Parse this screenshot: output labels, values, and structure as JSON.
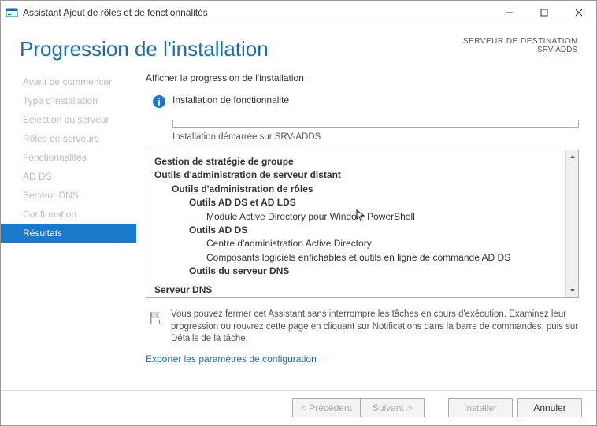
{
  "titlebar": {
    "title": "Assistant Ajout de rôles et de fonctionnalités"
  },
  "header": {
    "page_title": "Progression de l'installation",
    "dest_label": "SERVEUR DE DESTINATION",
    "dest_server": "SRV-ADDS"
  },
  "sidebar": {
    "steps": [
      "Avant de commencer",
      "Type d'installation",
      "Sélection du serveur",
      "Rôles de serveurs",
      "Fonctionnalités",
      "AD DS",
      "Serveur DNS",
      "Confirmation",
      "Résultats"
    ],
    "active_index": 8
  },
  "main": {
    "section_label": "Afficher la progression de l'installation",
    "status_text": "Installation de fonctionnalité",
    "progress_sub": "Installation démarrée sur SRV-ADDS",
    "details": {
      "l0a": "Gestion de stratégie de groupe",
      "l0b": "Outils d'administration de serveur distant",
      "l1a": "Outils d'administration de rôles",
      "l2a": "Outils AD DS et AD LDS",
      "l3a_pre": "Module Active Directory pour Windo",
      "l3a_post": " PowerShell",
      "l2b": "Outils AD DS",
      "l3b": "Centre d'administration Active Directory",
      "l3c": "Composants logiciels enfichables et outils en ligne de commande AD DS",
      "l2c": "Outils du serveur DNS",
      "l0c": "Serveur DNS"
    },
    "tip_text": "Vous pouvez fermer cet Assistant sans interrompre les tâches en cours d'exécution. Examinez leur progression ou rouvrez cette page en cliquant sur Notifications dans la barre de commandes, puis sur Détails de la tâche.",
    "export_link": "Exporter les paramètres de configuration"
  },
  "footer": {
    "prev": "< Précédent",
    "next": "Suivant >",
    "install": "Installer",
    "cancel": "Annuler"
  }
}
